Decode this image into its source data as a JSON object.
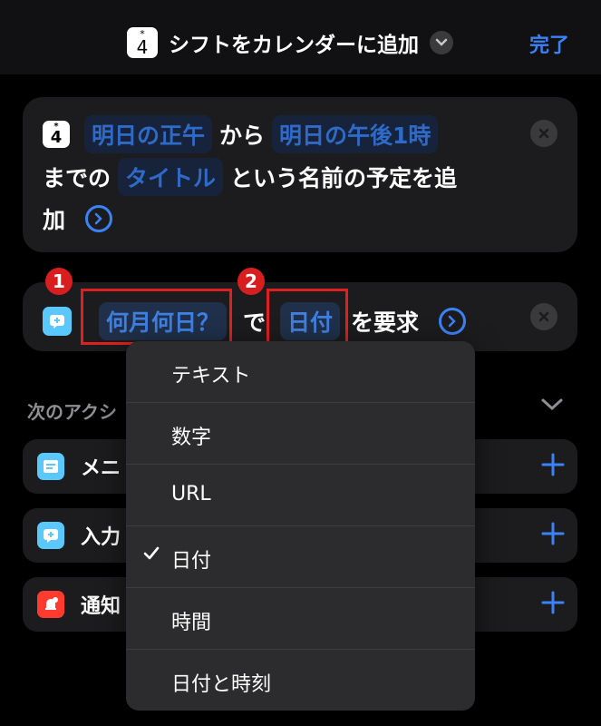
{
  "header": {
    "app_icon": {
      "star": "*",
      "number": "4"
    },
    "title": "シフトをカレンダーに追加",
    "done_label": "完了"
  },
  "action_calendar": {
    "icon": {
      "star": "*",
      "number": "4"
    },
    "start_token": "明日の正午",
    "text_from": "から",
    "end_token": "明日の午後1時",
    "text_until": "までの",
    "title_token": "タイトル",
    "text_event": "という名前の予定を追",
    "text_event_cont": "加"
  },
  "action_ask": {
    "question_token": "何月何日？",
    "text_de": "で",
    "type_token": "日付",
    "text_request": "を要求"
  },
  "annotations": {
    "badge1": "1",
    "badge2": "2"
  },
  "next_actions": {
    "label": "次のアクシ",
    "items": [
      {
        "label": "メニ",
        "icon": "menu-icon",
        "color": "#5ac8fa"
      },
      {
        "label": "入力",
        "icon": "ask-input-icon",
        "color": "#5ac8fa"
      },
      {
        "label": "通知",
        "icon": "notification-icon",
        "color": "#ff3b30"
      }
    ]
  },
  "type_menu": {
    "selected_index": 3,
    "options": [
      "テキスト",
      "数字",
      "URL",
      "日付",
      "時間",
      "日付と時刻"
    ]
  },
  "colors": {
    "accent": "#3b82f6",
    "token_bg": "#20304a",
    "annotation_red": "#e02020"
  }
}
